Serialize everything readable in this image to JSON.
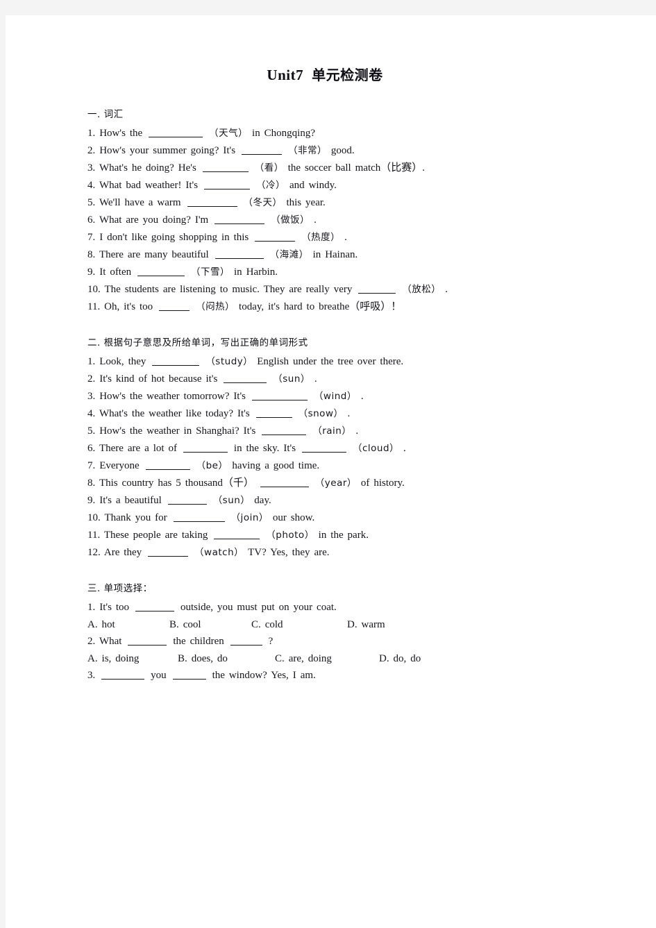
{
  "document": {
    "title_en": "Unit7",
    "title_cn": "单元检测卷"
  },
  "sections": [
    {
      "heading": "一. 词汇",
      "items": [
        {
          "num": "1.",
          "pre": "How's the",
          "blank": 78,
          "cn": "（天气）",
          "post": "in Chongqing?"
        },
        {
          "num": "2.",
          "pre": "How's your summer going? It's",
          "blank": 58,
          "cn": "（非常）",
          "post": "good."
        },
        {
          "num": "3.",
          "pre": "What's he doing? He's",
          "blank": 66,
          "cn": "（看）",
          "post": "the soccer ball match（比赛）."
        },
        {
          "num": "4.",
          "pre": "What bad weather! It's",
          "blank": 66,
          "cn": "（冷）",
          "post": "and windy."
        },
        {
          "num": "5.",
          "pre": "We'll have a warm",
          "blank": 72,
          "cn": "（冬天）",
          "post": "this year."
        },
        {
          "num": "6.",
          "pre": "What are you doing? I'm",
          "blank": 72,
          "cn": "（做饭）",
          "post": "."
        },
        {
          "num": "7.",
          "pre": "I don't like going shopping in this",
          "blank": 58,
          "cn": "（热度）",
          "post": "."
        },
        {
          "num": "8.",
          "pre": "There are many beautiful",
          "blank": 70,
          "cn": "（海滩）",
          "post": "in Hainan."
        },
        {
          "num": "9.",
          "pre": "It often",
          "blank": 68,
          "cn": "（下雪）",
          "post": "in Harbin."
        },
        {
          "num": "10.",
          "pre": "The students are listening to music. They are really very",
          "blank": 54,
          "cn": "（放松）",
          "post": "."
        },
        {
          "num": "11.",
          "pre": "Oh, it's too",
          "blank": 44,
          "cn": "（闷热）",
          "post": "today, it's hard to breathe（呼吸）！"
        }
      ]
    },
    {
      "heading": "二. 根据句子意思及所给单词，写出正确的单词形式",
      "items": [
        {
          "num": "1.",
          "pre": "Look, they",
          "blank": 68,
          "cn": "（study）",
          "post": "English under the tree over there."
        },
        {
          "num": "2.",
          "pre": "It's kind of hot because it's",
          "blank": 62,
          "cn": "（sun）",
          "post": "."
        },
        {
          "num": "3.",
          "pre": "How's the weather tomorrow? It's",
          "blank": 80,
          "cn": "（wind）",
          "post": "."
        },
        {
          "num": "4.",
          "pre": "What's the weather like today? It's",
          "blank": 52,
          "cn": "（snow）",
          "post": "."
        },
        {
          "num": "5.",
          "pre": "How's the weather in Shanghai? It's",
          "blank": 64,
          "cn": "（rain）",
          "post": "."
        },
        {
          "num": "6.",
          "pre": "There are a lot of",
          "blank": 64,
          "mid": "in the sky. It's",
          "blank2": 64,
          "cn": "（cloud）",
          "post": "."
        },
        {
          "num": "7.",
          "pre": "Everyone",
          "blank": 64,
          "cn": "（be）",
          "post": "having a good time."
        },
        {
          "num": "8.",
          "pre": "This country has 5 thousand（千）",
          "blank": 70,
          "cn": "（year）",
          "post": "of history."
        },
        {
          "num": "9.",
          "pre": "It's a beautiful",
          "blank": 56,
          "cn": "（sun）",
          "post": "day."
        },
        {
          "num": "10.",
          "pre": "Thank you for",
          "blank": 74,
          "cn": "（join）",
          "post": "our show."
        },
        {
          "num": "11.",
          "pre": "These people are taking",
          "blank": 66,
          "cn": "（photo）",
          "post": "in the park."
        },
        {
          "num": "12.",
          "pre": "Are they",
          "blank": 58,
          "cn": "（watch）",
          "post": "TV? Yes, they are."
        }
      ]
    },
    {
      "heading": "三. 单项选择：",
      "items": [
        {
          "num": "1.",
          "pre": "It's too",
          "blank": 56,
          "post": "outside, you must put on your coat."
        },
        {
          "num": "2.",
          "pre": "What",
          "blank": 56,
          "mid": "the children",
          "blank2": 46,
          "post": "?"
        },
        {
          "num": "3.",
          "pre": "",
          "blank": 62,
          "mid": "you",
          "blank2": 48,
          "post": "the window? Yes, I am."
        }
      ],
      "choices": [
        {
          "after": 0,
          "options": [
            "A. hot",
            "B. cool",
            "C. cold",
            "D. warm"
          ],
          "widths": [
            118,
            118,
            138
          ]
        },
        {
          "after": 1,
          "options": [
            "A. is, doing",
            "B. does, do",
            "C. are, doing",
            "D. do, do"
          ],
          "widths": [
            130,
            140,
            150
          ]
        }
      ]
    }
  ]
}
